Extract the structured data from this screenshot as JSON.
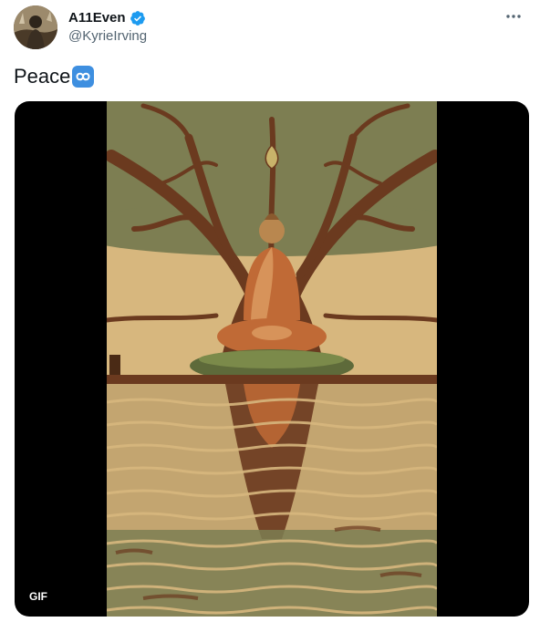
{
  "user": {
    "display_name": "A11Even",
    "handle": "@KyrieIrving",
    "verified_icon": "verified-badge-icon"
  },
  "tweet": {
    "text": "Peace",
    "emoji": "infinity-icon"
  },
  "media": {
    "badge": "GIF"
  },
  "colors": {
    "accent": "#1d9bf0",
    "muted": "#536471",
    "art_sky": "#d7b77e",
    "art_tree": "#6b3a1f",
    "art_foliage": "#7d7e52",
    "art_robe": "#c06a36"
  }
}
